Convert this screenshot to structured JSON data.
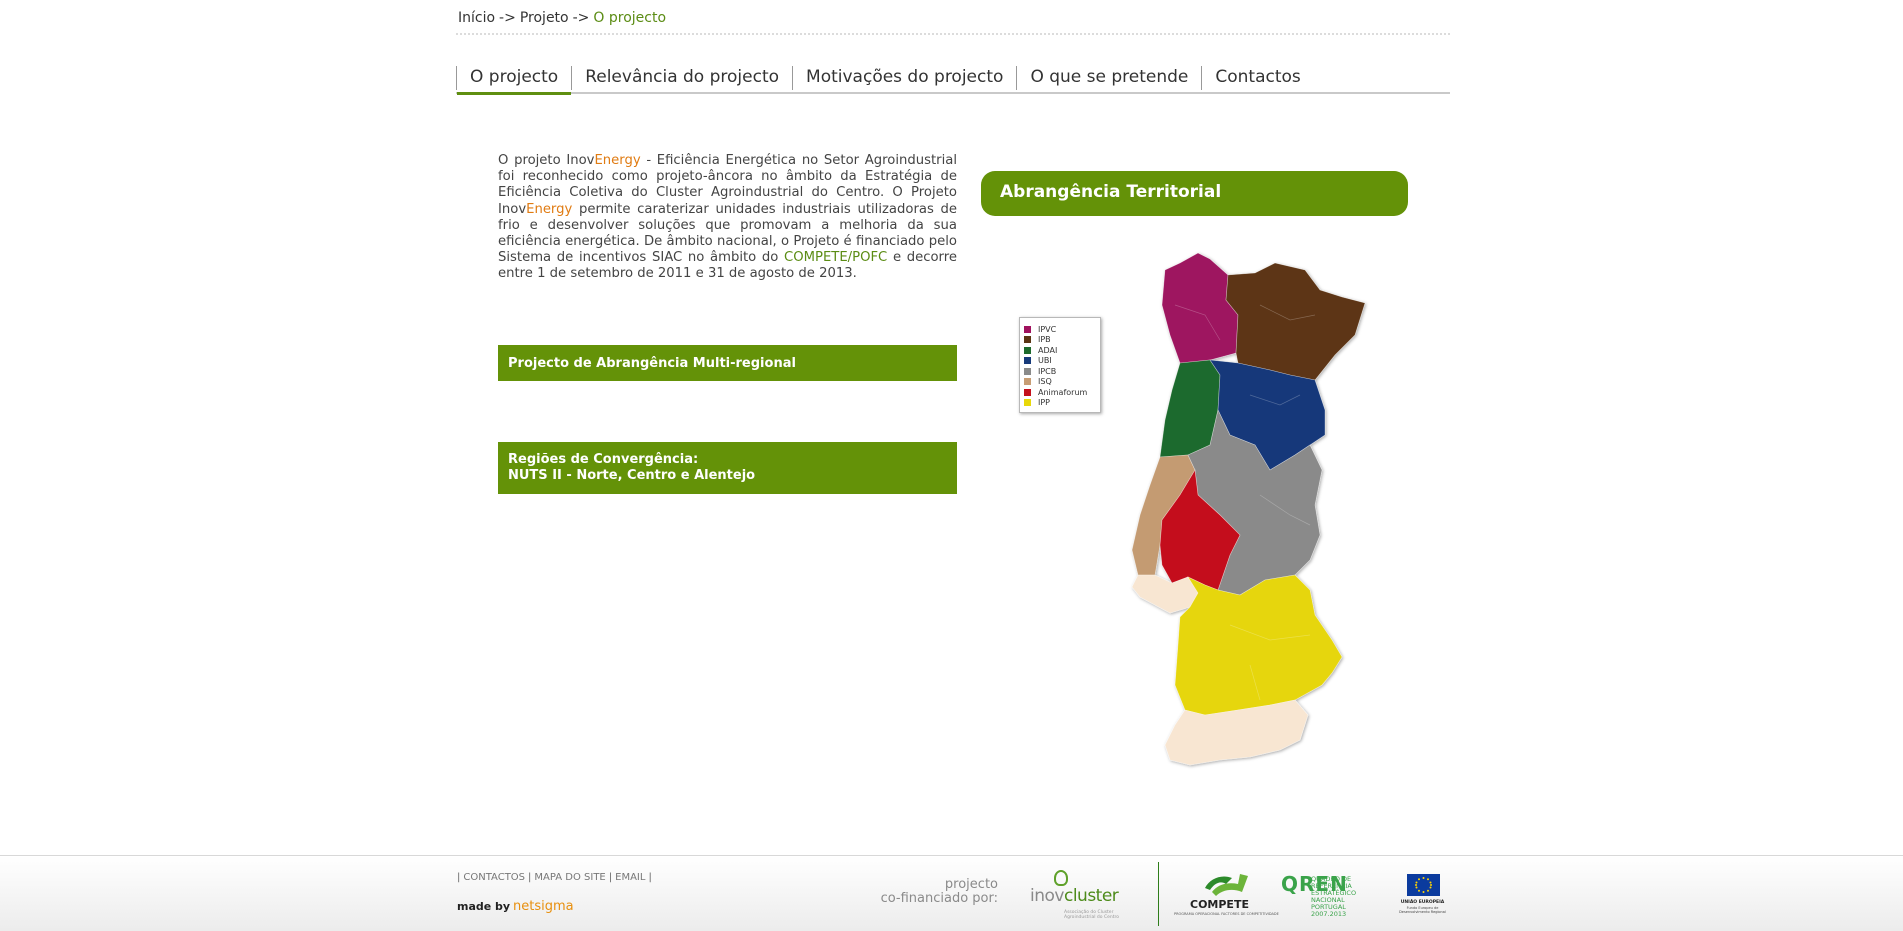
{
  "breadcrumb": {
    "home": "Início",
    "sep1": "->",
    "parent": "Projeto",
    "sep2": "->",
    "current": "O projecto"
  },
  "tabs": [
    {
      "label": "O projecto",
      "active": true
    },
    {
      "label": "Relevância do projecto"
    },
    {
      "label": "Motivações do projecto"
    },
    {
      "label": "O que se pretende"
    },
    {
      "label": "Contactos"
    }
  ],
  "intro": {
    "t1": "O projeto Inov",
    "t2": "Energy",
    "t3": " - Eficiência Energética no Setor Agroindustrial foi reconhecido como projeto-âncora no âmbito da Estratégia de Eficiência Coletiva do Cluster Agroindustrial do Centro. O Projeto Inov",
    "t4": "Energy",
    "t5": " permite caraterizar unidades industriais utilizadoras de frio e desenvolver soluções que promovam a melhoria da sua eficiência energética. De âmbito nacional, o Projeto é financiado pelo Sistema de incentivos SIAC no âmbito do ",
    "t6": "COMPETE/POFC",
    "t7": " e decorre entre 1 de setembro de 2011 e 31 de agosto de 2013."
  },
  "boxes": {
    "multiregional": "Projecto de Abrangência Multi-regional",
    "convergence_line1": "Regiões de Convergência:",
    "convergence_line2": "NUTS II - Norte, Centro e Alentejo"
  },
  "territorial": {
    "title": "Abrangência Territorial",
    "legend": [
      {
        "label": "IPVC",
        "color": "#a0125e"
      },
      {
        "label": "IPB",
        "color": "#5b3514"
      },
      {
        "label": "ADAI",
        "color": "#1d6a2c"
      },
      {
        "label": "UBI",
        "color": "#173a7a"
      },
      {
        "label": "IPCB",
        "color": "#8a8a8a"
      },
      {
        "label": "ISQ",
        "color": "#c79d74"
      },
      {
        "label": "Animaforum",
        "color": "#c4101c"
      },
      {
        "label": "IPP",
        "color": "#e8d80a"
      }
    ]
  },
  "footer": {
    "links": [
      "CONTACTOS",
      "MAPA DO SITE",
      "EMAIL"
    ],
    "pipe": "|",
    "made_by": "made by",
    "netsigma": "netsigma",
    "cofin_line1": "projecto",
    "cofin_line2": "co-financiado por:",
    "inov_a": "inov",
    "inov_b": "cluster",
    "inov_sub": "Associação do Cluster Agroindustrial do Centro",
    "compete": "COMPETE",
    "compete_sub": "PROGRAMA OPERACIONAL FACTORES DE COMPETITIVIDADE",
    "qren_big": "QREN",
    "qren_small": "QUADRO DE REFERÊNCIA ESTRATÉGICO NACIONAL PORTUGAL 2007.2013",
    "ue_title": "UNIÃO EUROPEIA",
    "ue_sub": "Fundo Europeu de Desenvolvimento Regional"
  }
}
